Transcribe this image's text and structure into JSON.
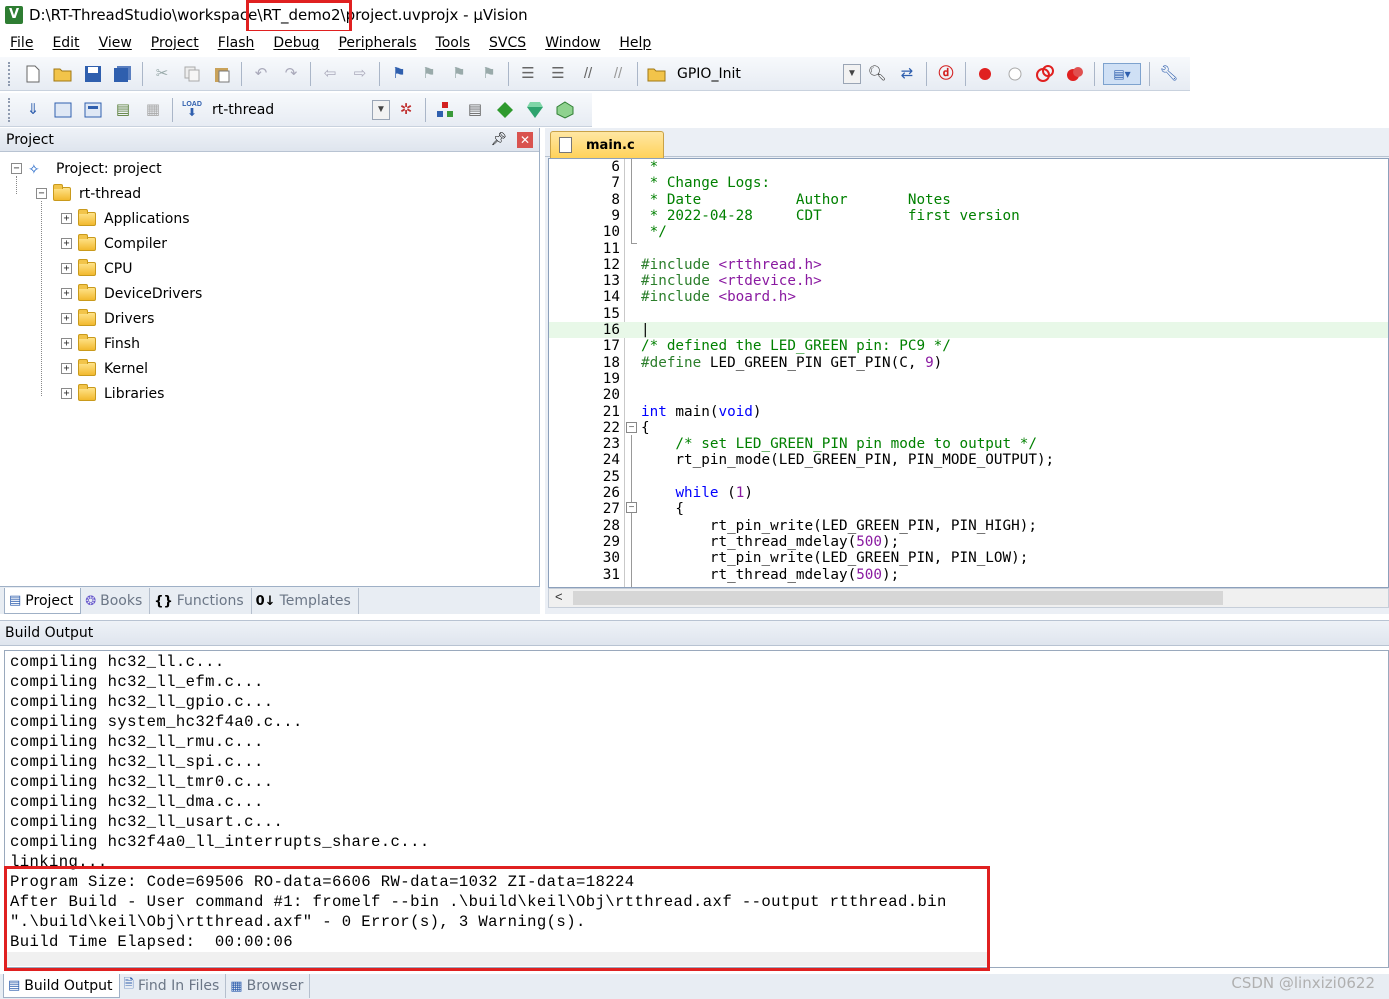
{
  "window": {
    "title": "D:\\RT-ThreadStudio\\workspace\\RT_demo2\\project.uvprojx - µVision",
    "app_icon": "V"
  },
  "menu": [
    "File",
    "Edit",
    "View",
    "Project",
    "Flash",
    "Debug",
    "Peripherals",
    "Tools",
    "SVCS",
    "Window",
    "Help"
  ],
  "toolbar1": {
    "function_combo": "GPIO_Init"
  },
  "toolbar2": {
    "target_combo": "rt-thread",
    "load_label": "LOAD"
  },
  "project_panel": {
    "header": "Project",
    "tree": {
      "root": "Project: project",
      "target": "rt-thread",
      "groups": [
        "Applications",
        "Compiler",
        "CPU",
        "DeviceDrivers",
        "Drivers",
        "Finsh",
        "Kernel",
        "Libraries"
      ]
    },
    "tabs": [
      "Project",
      "Books",
      "Functions",
      "Templates"
    ]
  },
  "editor": {
    "tab": "main.c",
    "lines": [
      {
        "n": "6",
        "text": " *"
      },
      {
        "n": "7",
        "text": " * Change Logs:"
      },
      {
        "n": "8",
        "text": " * Date           Author       Notes"
      },
      {
        "n": "9",
        "text": " * 2022-04-28     CDT          first version"
      },
      {
        "n": "10",
        "text": " */"
      },
      {
        "n": "11",
        "text": ""
      },
      {
        "n": "12",
        "text": "#include <rtthread.h>"
      },
      {
        "n": "13",
        "text": "#include <rtdevice.h>"
      },
      {
        "n": "14",
        "text": "#include <board.h>"
      },
      {
        "n": "15",
        "text": ""
      },
      {
        "n": "16",
        "text": "|"
      },
      {
        "n": "17",
        "text": "/* defined the LED_GREEN pin: PC9 */"
      },
      {
        "n": "18",
        "text": "#define LED_GREEN_PIN GET_PIN(C, 9)"
      },
      {
        "n": "19",
        "text": ""
      },
      {
        "n": "20",
        "text": ""
      },
      {
        "n": "21",
        "text": "int main(void)"
      },
      {
        "n": "22",
        "text": "{"
      },
      {
        "n": "23",
        "text": "    /* set LED_GREEN_PIN pin mode to output */"
      },
      {
        "n": "24",
        "text": "    rt_pin_mode(LED_GREEN_PIN, PIN_MODE_OUTPUT);"
      },
      {
        "n": "25",
        "text": ""
      },
      {
        "n": "26",
        "text": "    while (1)"
      },
      {
        "n": "27",
        "text": "    {"
      },
      {
        "n": "28",
        "text": "        rt_pin_write(LED_GREEN_PIN, PIN_HIGH);"
      },
      {
        "n": "29",
        "text": "        rt_thread_mdelay(500);"
      },
      {
        "n": "30",
        "text": "        rt_pin_write(LED_GREEN_PIN, PIN_LOW);"
      },
      {
        "n": "31",
        "text": "        rt_thread_mdelay(500);"
      }
    ]
  },
  "build_output": {
    "header": "Build Output",
    "lines": [
      "compiling hc32_ll.c...",
      "compiling hc32_ll_efm.c...",
      "compiling hc32_ll_gpio.c...",
      "compiling system_hc32f4a0.c...",
      "compiling hc32_ll_rmu.c...",
      "compiling hc32_ll_spi.c...",
      "compiling hc32_ll_tmr0.c...",
      "compiling hc32_ll_dma.c...",
      "compiling hc32_ll_usart.c...",
      "compiling hc32f4a0_ll_interrupts_share.c...",
      "linking...",
      "Program Size: Code=69506 RO-data=6606 RW-data=1032 ZI-data=18224",
      "After Build - User command #1: fromelf --bin .\\build\\keil\\Obj\\rtthread.axf --output rtthread.bin",
      "\".\\build\\keil\\Obj\\rtthread.axf\" - 0 Error(s), 3 Warning(s).",
      "Build Time Elapsed:  00:00:06"
    ],
    "tabs": [
      "Build Output",
      "Find In Files",
      "Browser"
    ]
  },
  "watermark": "CSDN @linxizi0622",
  "colors": {
    "highlight_box": "#e02020",
    "comment": "#008000",
    "keyword": "#0000ff",
    "include_target": "#8a1aa1",
    "current_line": "#e8f8e8"
  }
}
